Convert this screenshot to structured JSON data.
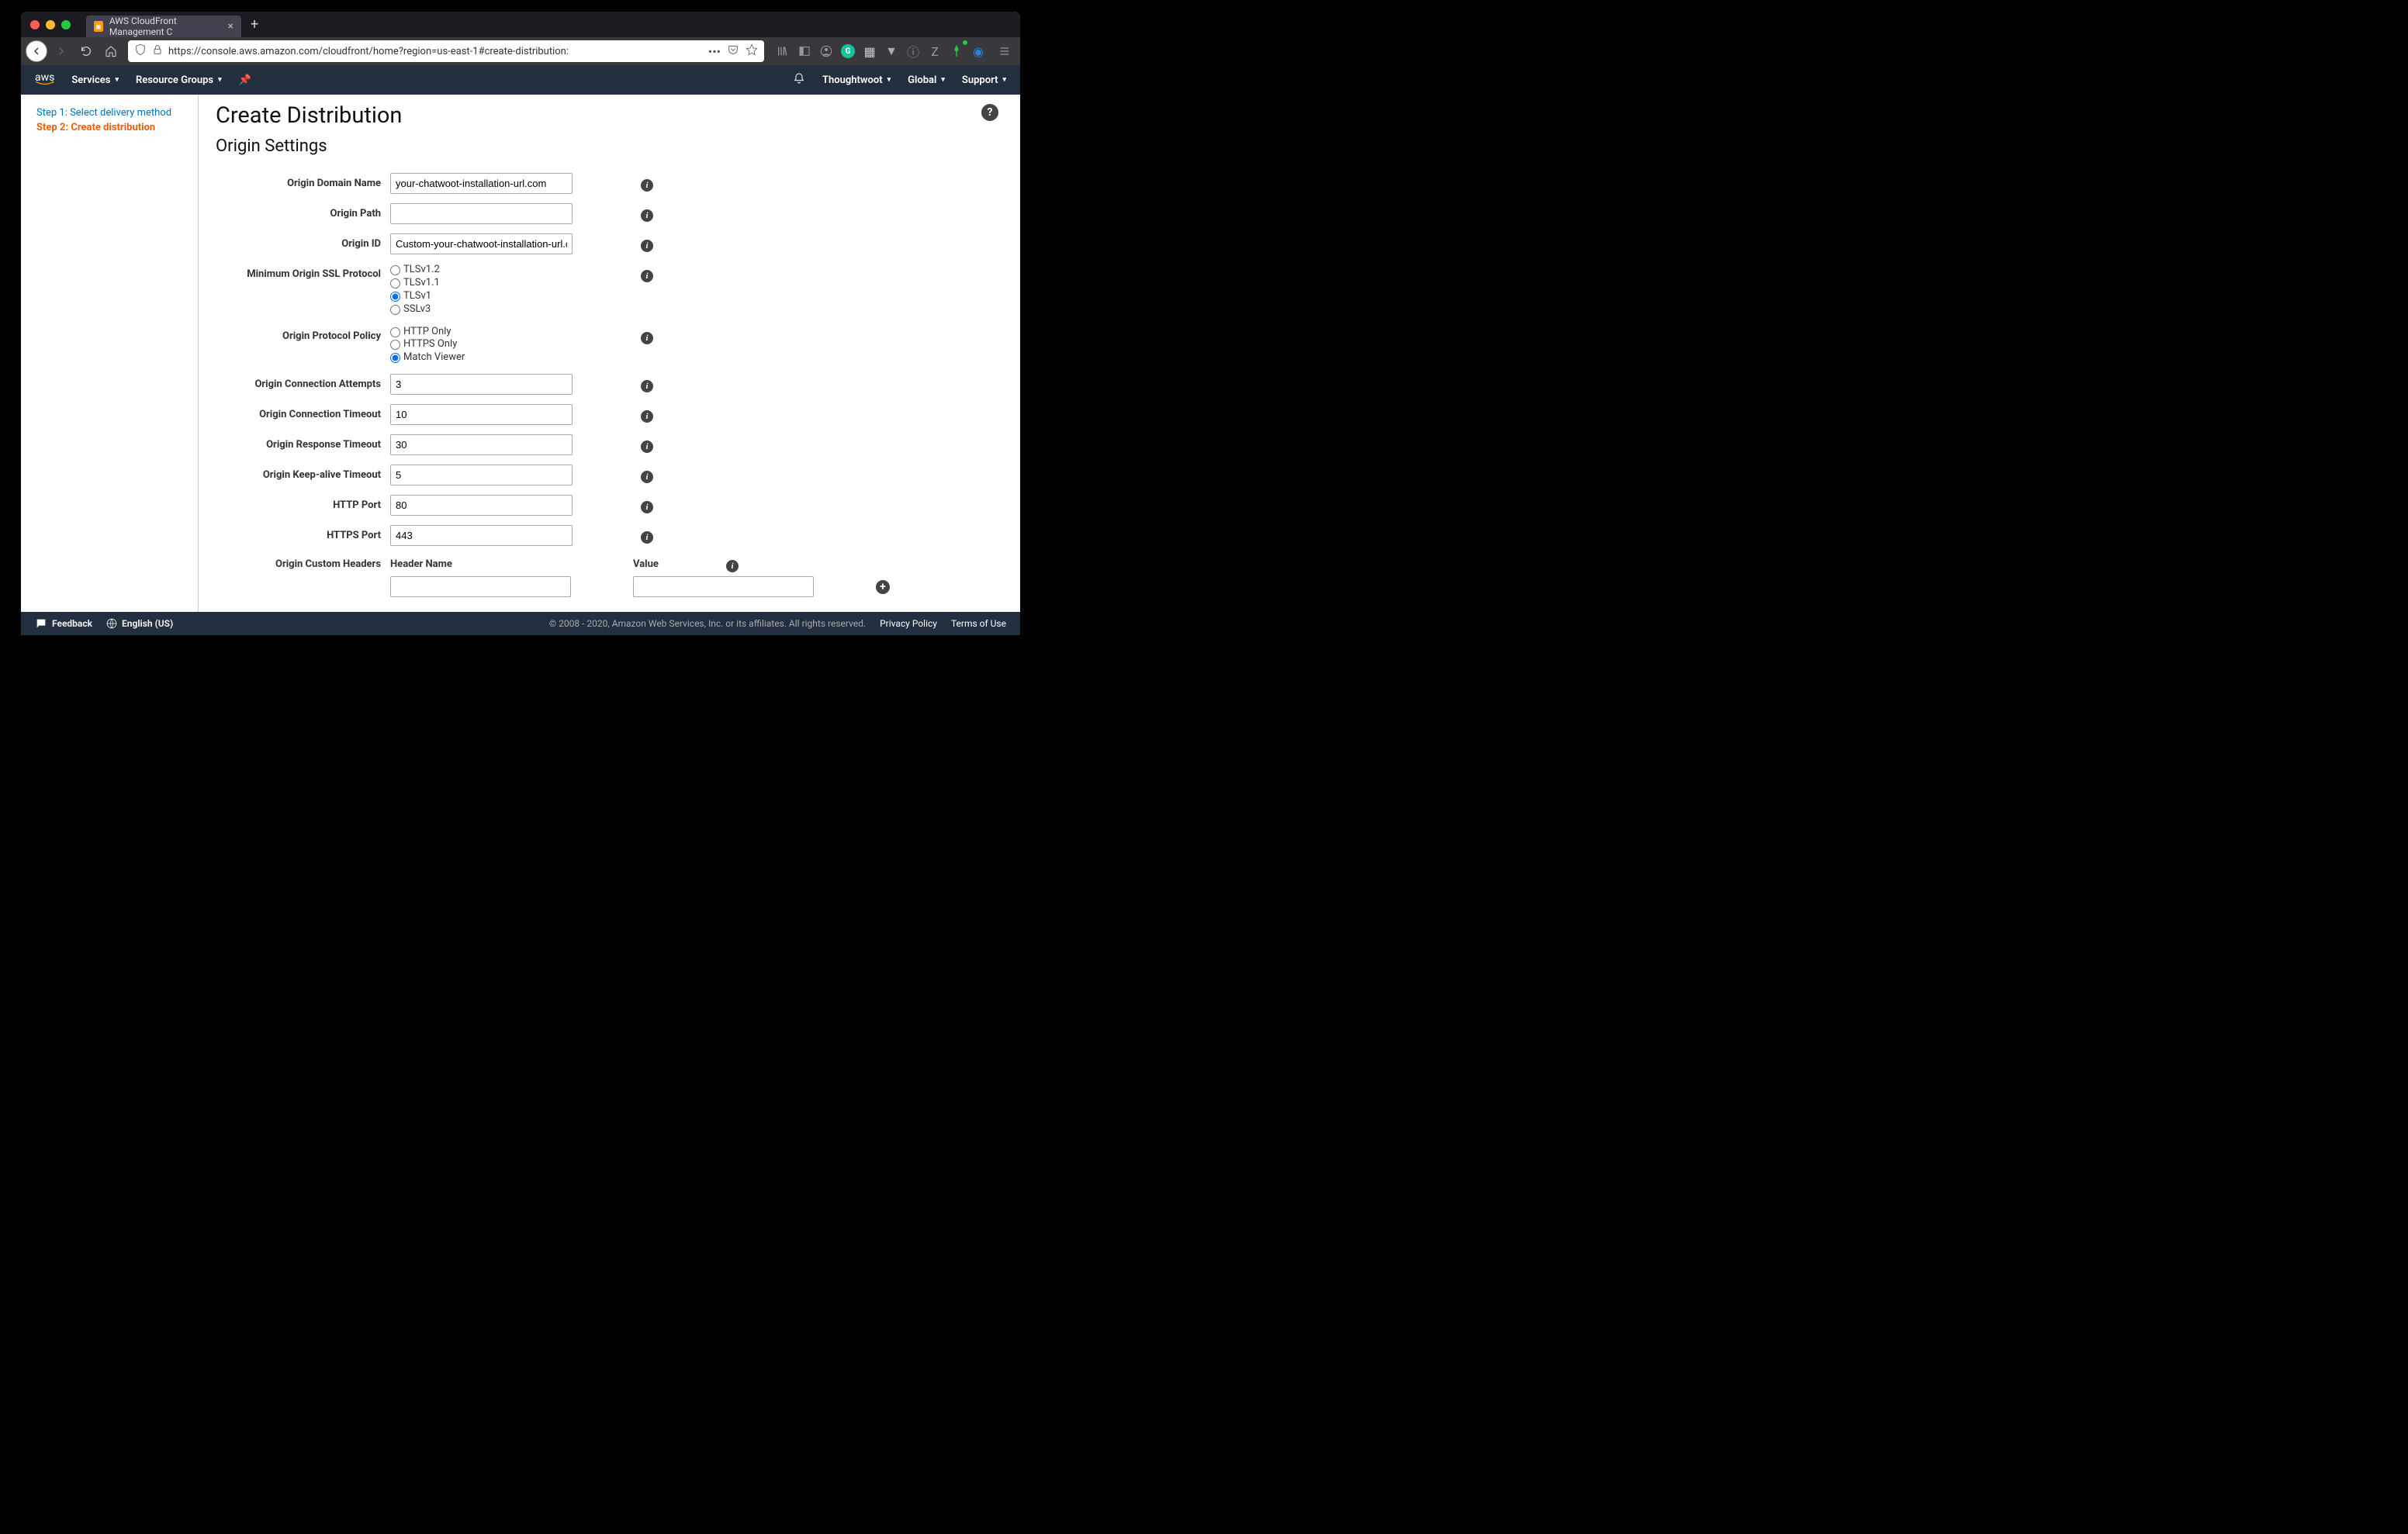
{
  "browser": {
    "tab_title": "AWS CloudFront Management C",
    "url": "https://console.aws.amazon.com/cloudfront/home?region=us-east-1#create-distribution:"
  },
  "header": {
    "logo": "aws",
    "services": "Services",
    "resource_groups": "Resource Groups",
    "account": "Thoughtwoot",
    "region": "Global",
    "support": "Support"
  },
  "sidebar": {
    "step1": "Step 1: Select delivery method",
    "step2": "Step 2: Create distribution"
  },
  "page": {
    "title": "Create Distribution",
    "section": "Origin Settings"
  },
  "form": {
    "origin_domain_name": {
      "label": "Origin Domain Name",
      "value": "your-chatwoot-installation-url.com"
    },
    "origin_path": {
      "label": "Origin Path",
      "value": ""
    },
    "origin_id": {
      "label": "Origin ID",
      "value": "Custom-your-chatwoot-installation-url.com"
    },
    "ssl_protocol": {
      "label": "Minimum Origin SSL Protocol",
      "options": [
        "TLSv1.2",
        "TLSv1.1",
        "TLSv1",
        "SSLv3"
      ],
      "selected": "TLSv1"
    },
    "protocol_policy": {
      "label": "Origin Protocol Policy",
      "options": [
        "HTTP Only",
        "HTTPS Only",
        "Match Viewer"
      ],
      "selected": "Match Viewer"
    },
    "connection_attempts": {
      "label": "Origin Connection Attempts",
      "value": "3"
    },
    "connection_timeout": {
      "label": "Origin Connection Timeout",
      "value": "10"
    },
    "response_timeout": {
      "label": "Origin Response Timeout",
      "value": "30"
    },
    "keepalive_timeout": {
      "label": "Origin Keep-alive Timeout",
      "value": "5"
    },
    "http_port": {
      "label": "HTTP Port",
      "value": "80"
    },
    "https_port": {
      "label": "HTTPS Port",
      "value": "443"
    },
    "custom_headers": {
      "label": "Origin Custom Headers",
      "header_name_label": "Header Name",
      "value_label": "Value"
    }
  },
  "footer": {
    "feedback": "Feedback",
    "language": "English (US)",
    "copyright": "© 2008 - 2020, Amazon Web Services, Inc. or its affiliates. All rights reserved.",
    "privacy": "Privacy Policy",
    "terms": "Terms of Use"
  }
}
